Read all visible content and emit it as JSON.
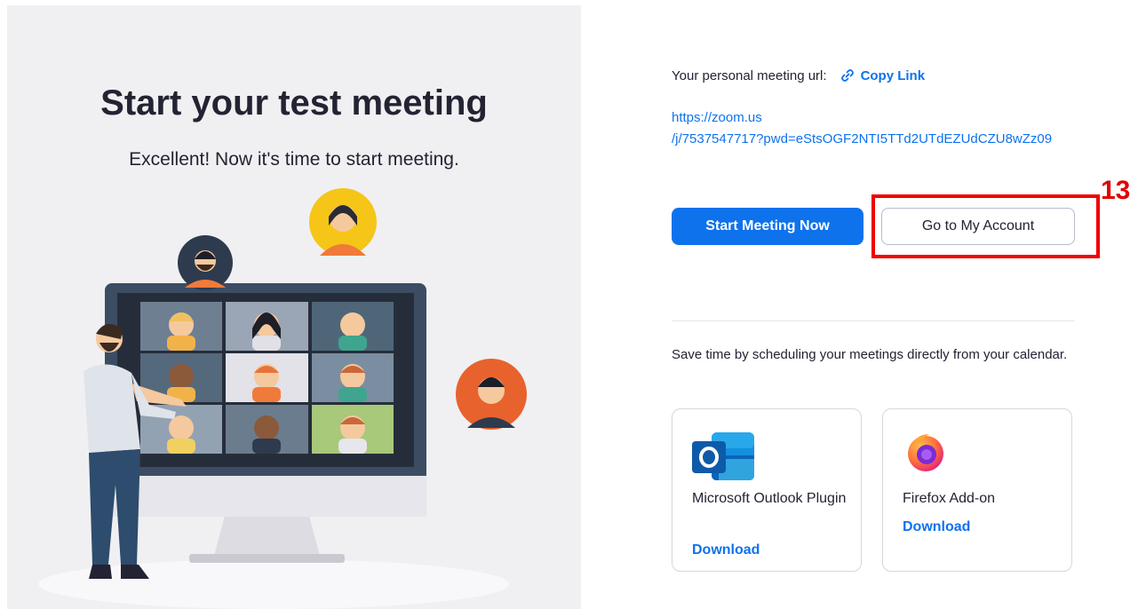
{
  "hero": {
    "title": "Start your test meeting",
    "subtitle": "Excellent! Now it's time to start meeting."
  },
  "meeting": {
    "url_label": "Your personal meeting url:",
    "copy_link_label": "Copy Link",
    "url_line1": "https://zoom.us",
    "url_line2": "/j/7537547717?pwd=eStsOGF2NTI5TTd2UTdEZUdCZU8wZz09"
  },
  "actions": {
    "start_label": "Start Meeting Now",
    "account_label": "Go to My Account"
  },
  "annotation": {
    "step_number": "13",
    "highlight_color": "#ee0000"
  },
  "schedule": {
    "text": "Save time by scheduling your meetings directly from your calendar."
  },
  "plugins": [
    {
      "name": "Microsoft Outlook Plugin",
      "download_label": "Download",
      "icon": "outlook-icon"
    },
    {
      "name": "Firefox Add-on",
      "download_label": "Download",
      "icon": "firefox-icon"
    }
  ],
  "colors": {
    "accent": "#0e72ed",
    "panel_bg": "#f0f0f2",
    "text": "#232333"
  }
}
